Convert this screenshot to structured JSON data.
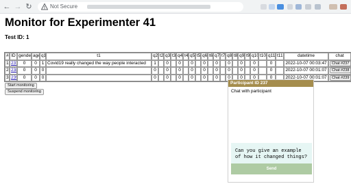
{
  "browser": {
    "security_label": "Not Secure",
    "nav": {
      "back": "←",
      "forward": "→",
      "reload": "↻"
    },
    "icons": [
      "back-arrow-icon",
      "forward-arrow-icon",
      "reload-icon",
      "warning-triangle-icon"
    ],
    "extension_colors": [
      "#d8dbe0",
      "#c4d6ee",
      "#4a8fe0",
      "#d3d7dd",
      "#9fb7d8",
      "#c8cdd4",
      "#b9c3cf",
      "#d0bfb0",
      "#c46e5a"
    ]
  },
  "page": {
    "title": "Monitor for Experimenter 41",
    "test_id_label": "Test ID: 1"
  },
  "table": {
    "headers": [
      "#",
      "ID",
      "gender",
      "age",
      "q1",
      "t1",
      "q2",
      "t2",
      "q3",
      "t3",
      "q4",
      "t4",
      "q5",
      "t5",
      "q6",
      "t6",
      "q7",
      "t7",
      "q8",
      "t8",
      "q9",
      "t9",
      "q10",
      "t10",
      "q11",
      "t11",
      "datetime",
      "chat"
    ],
    "rows": [
      {
        "num": "1",
        "id": "237",
        "gender": "0",
        "age": "0",
        "q1": "1",
        "t1": "Covid19 really changed the way people interacted",
        "q2": "1",
        "t2": "",
        "q3": "0",
        "t3": "",
        "q4": "0",
        "t4": "",
        "q5": "0",
        "t5": "",
        "q6": "0",
        "t6": "",
        "q7": "0",
        "t7": "",
        "q8": "0",
        "t8": "",
        "q9": "0",
        "t9": "",
        "q10": "0",
        "t10": "",
        "q11": "0",
        "t11": "",
        "datetime": "2022-10-07 00:03:47",
        "chat": "Chat #237"
      },
      {
        "num": "2",
        "id": "238",
        "gender": "0",
        "age": "0",
        "q1": "0",
        "t1": "",
        "q2": "0",
        "t2": "",
        "q3": "0",
        "t3": "",
        "q4": "0",
        "t4": "",
        "q5": "0",
        "t5": "",
        "q6": "0",
        "t6": "",
        "q7": "0",
        "t7": "",
        "q8": "0",
        "t8": "",
        "q9": "0",
        "t9": "",
        "q10": "0",
        "t10": "",
        "q11": "0",
        "t11": "",
        "datetime": "2022-10-07 00:01:07",
        "chat": "Chat #238"
      },
      {
        "num": "3",
        "id": "239",
        "gender": "0",
        "age": "0",
        "q1": "0",
        "t1": "",
        "q2": "0",
        "t2": "",
        "q3": "0",
        "t3": "",
        "q4": "0",
        "t4": "",
        "q5": "0",
        "t5": "",
        "q6": "0",
        "t6": "",
        "q7": "0",
        "t7": "",
        "q8": "0",
        "t8": "",
        "q9": "0",
        "t9": "",
        "q10": "0",
        "t10": "",
        "q11": "0",
        "t11": "",
        "datetime": "2022-10-07 00:01:07",
        "chat": "Chat #239"
      }
    ]
  },
  "controls": {
    "start_label": "Start monitoring",
    "suspend_label": "Suspend monitoring"
  },
  "chat_panel": {
    "header": "Participant ID 237",
    "subtitle": "Chat with participant",
    "message_draft": "Can you give an example of how it changed things?",
    "send_label": "Send",
    "header_color": "#a58d4d",
    "input_bg_color": "#e6f6f4",
    "send_button_color": "#aecba3"
  }
}
